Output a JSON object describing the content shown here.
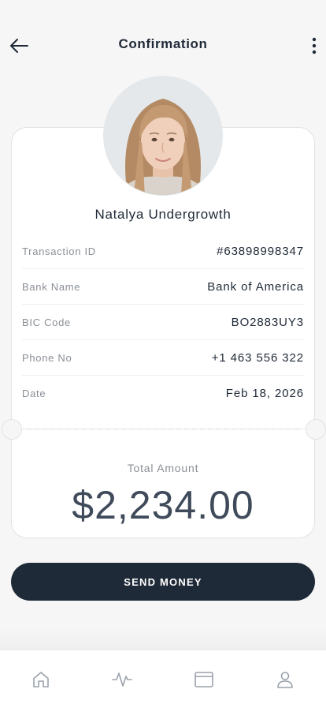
{
  "header": {
    "title": "Confirmation",
    "back_icon": "arrow-left-icon",
    "more_icon": "more-vertical-icon"
  },
  "recipient": {
    "name": "Natalya Undergrowth"
  },
  "details": [
    {
      "label": "Transaction ID",
      "value": "#63898998347"
    },
    {
      "label": "Bank Name",
      "value": "Bank of America"
    },
    {
      "label": "BIC Code",
      "value": "BO2883UY3"
    },
    {
      "label": "Phone No",
      "value": "+1 463 556 322"
    },
    {
      "label": "Date",
      "value": "Feb 18, 2026"
    }
  ],
  "total": {
    "label": "Total Amount",
    "amount": "$2,234.00"
  },
  "actions": {
    "send_label": "SEND MONEY"
  },
  "nav": {
    "items": [
      "home-icon",
      "activity-icon",
      "card-icon",
      "user-icon"
    ]
  },
  "colors": {
    "background": "#f6f6f6",
    "primary": "#1f2a38",
    "amount_text": "#3f4a5a",
    "muted_text": "#8a8f96",
    "icon_inactive": "#9aa1ab"
  }
}
